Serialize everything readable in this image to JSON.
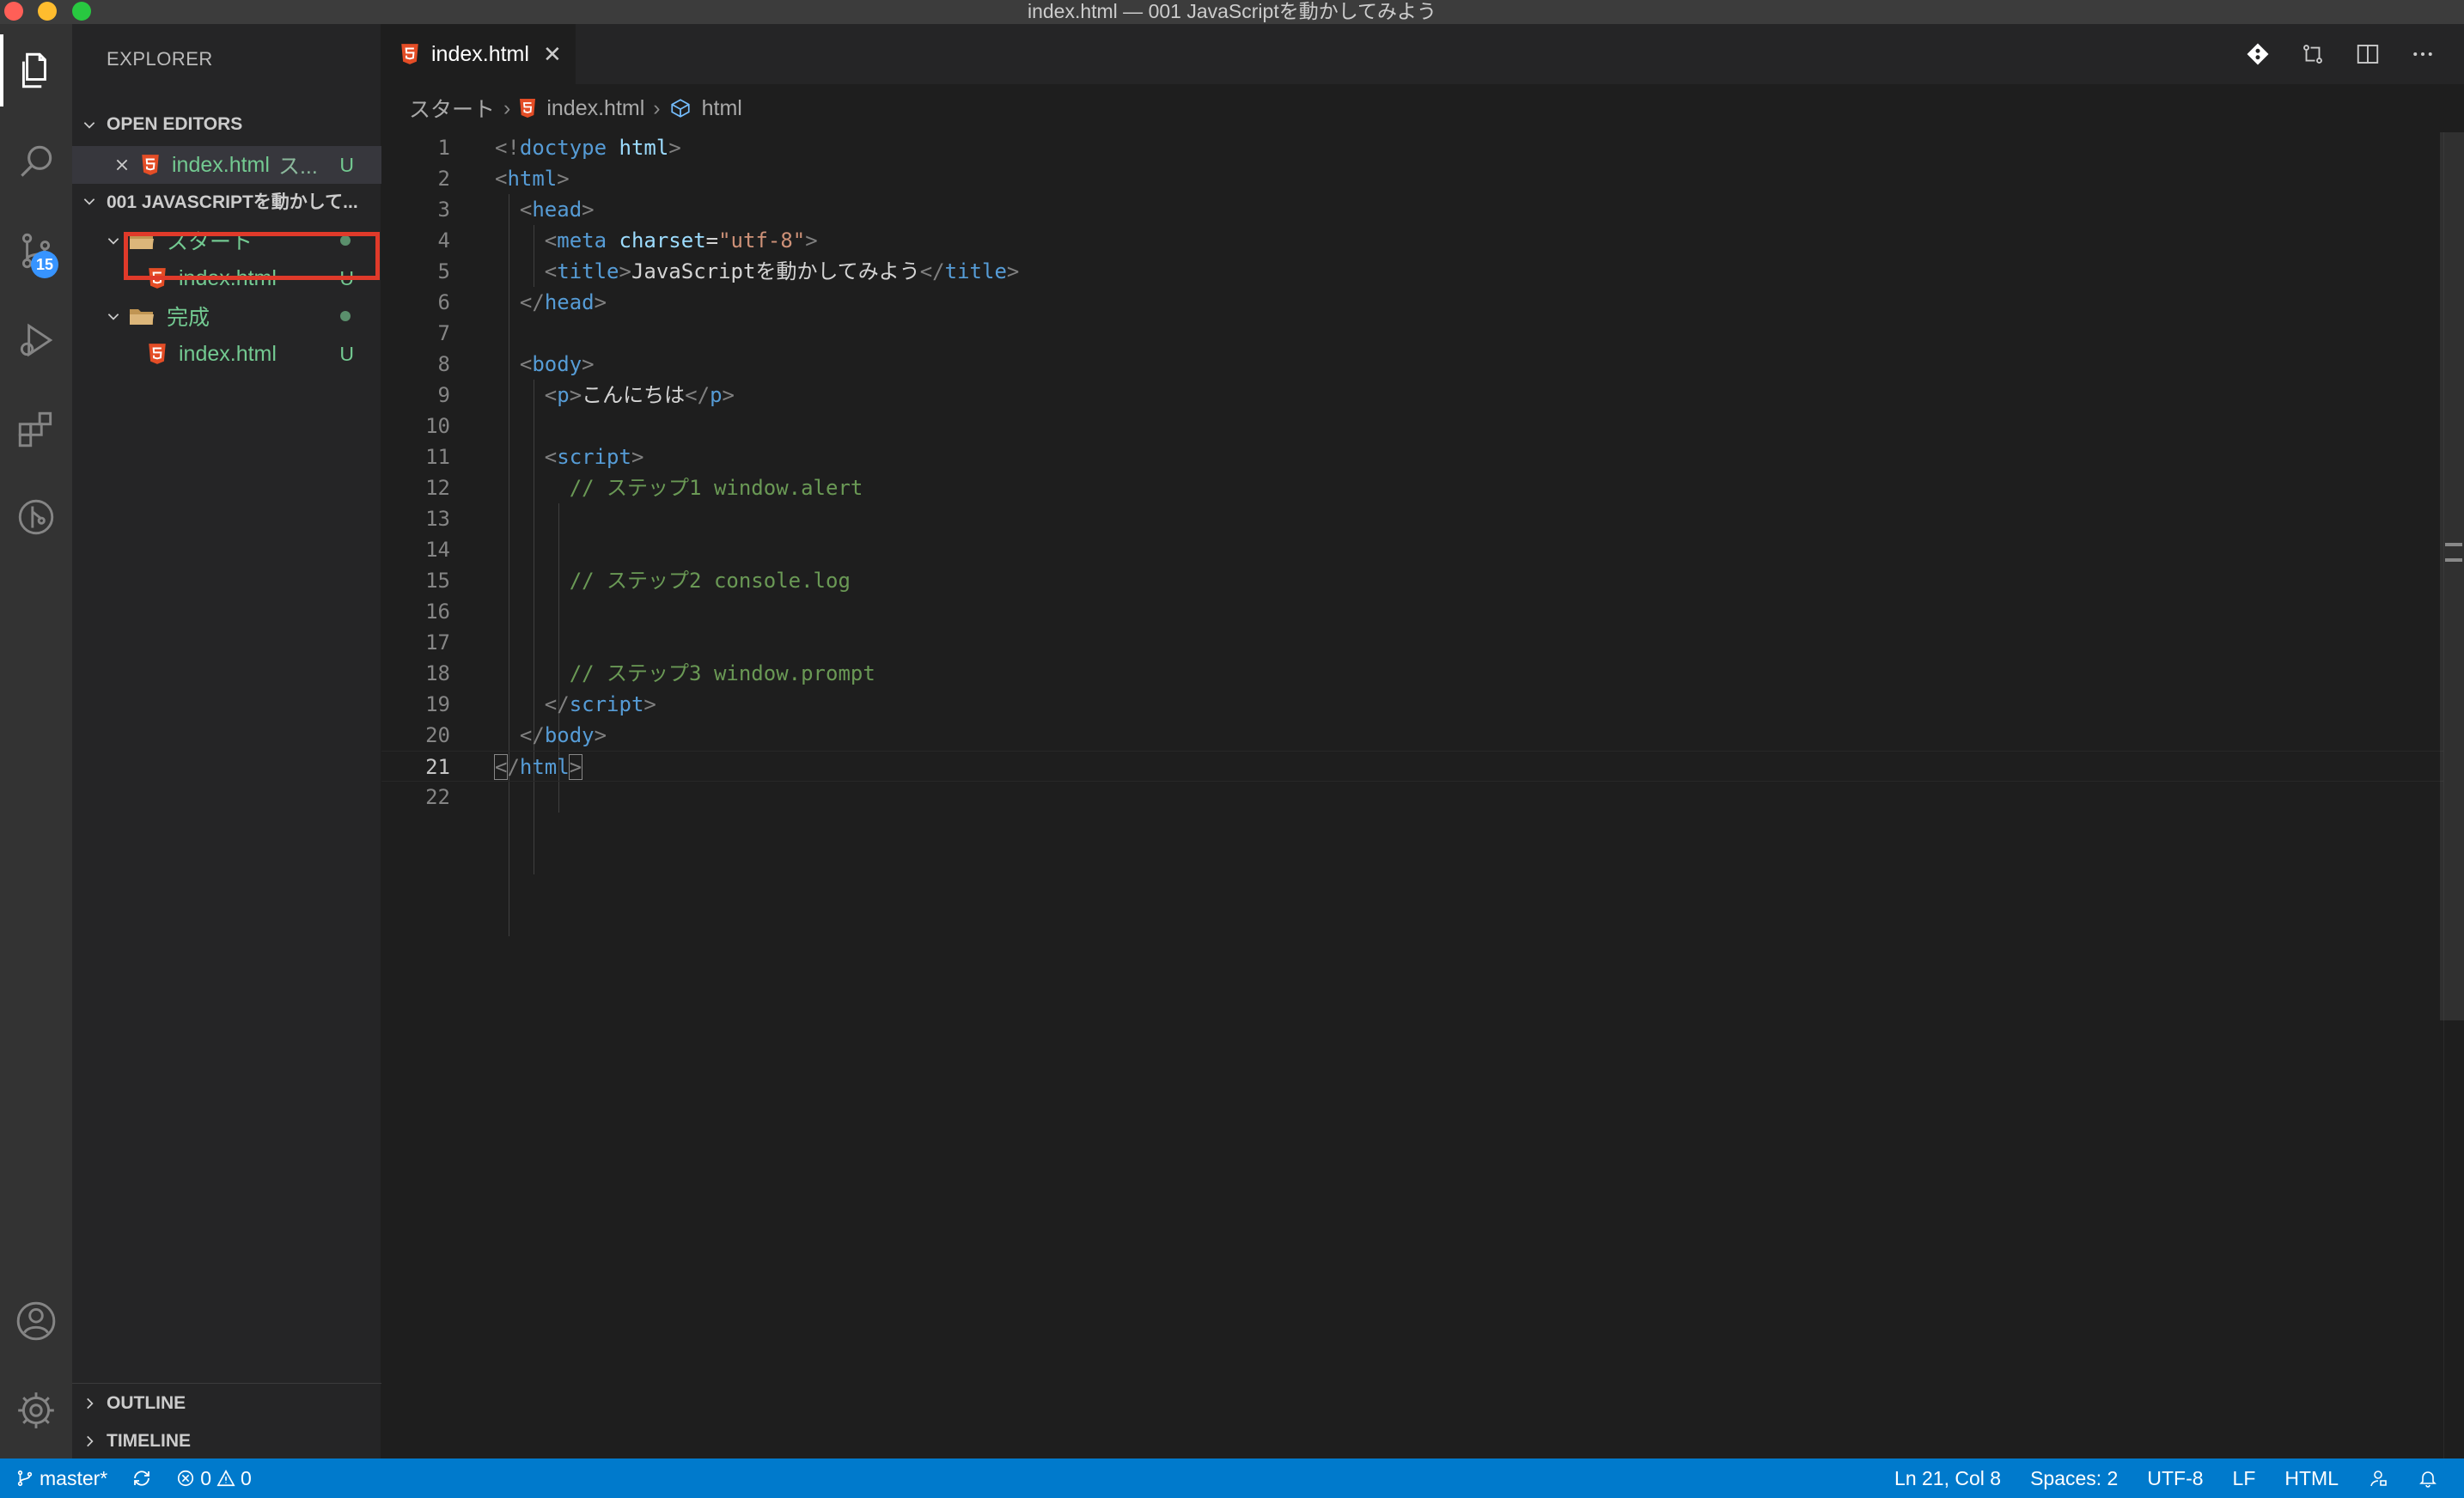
{
  "window": {
    "title": "index.html — 001 JavaScriptを動かしてみよう"
  },
  "sidebar": {
    "title": "EXPLORER",
    "open_editors": {
      "header": "OPEN EDITORS",
      "items": [
        {
          "name": "index.html",
          "desc": "ス...",
          "status": "U"
        }
      ]
    },
    "workspace": {
      "header": "001 JAVASCRIPTを動かして...",
      "folders": [
        {
          "name": "スタート",
          "files": [
            {
              "name": "index.html",
              "status": "U"
            }
          ]
        },
        {
          "name": "完成",
          "files": [
            {
              "name": "index.html",
              "status": "U"
            }
          ]
        }
      ]
    },
    "outline": "OUTLINE",
    "timeline": "TIMELINE"
  },
  "activity": {
    "source_control_badge": "15"
  },
  "tabs": [
    {
      "label": "index.html"
    }
  ],
  "breadcrumb": {
    "folder": "スタート",
    "file": "index.html",
    "symbol": "html"
  },
  "editor": {
    "line_numbers": [
      "1",
      "2",
      "3",
      "4",
      "5",
      "6",
      "7",
      "8",
      "9",
      "10",
      "11",
      "12",
      "13",
      "14",
      "15",
      "16",
      "17",
      "18",
      "19",
      "20",
      "21",
      "22"
    ],
    "tokens": {
      "doctype_kw": "doctype",
      "doctype_val": "html",
      "html": "html",
      "head": "head",
      "meta": "meta",
      "charset": "charset",
      "utf8": "\"utf-8\"",
      "title": "title",
      "title_text": "JavaScriptを動かしてみよう",
      "body": "body",
      "p": "p",
      "p_text": "こんにちは",
      "script": "script",
      "comment1": "// ステップ1 window.alert",
      "comment2": "// ステップ2 console.log",
      "comment3": "// ステップ3 window.prompt"
    }
  },
  "status": {
    "branch": "master*",
    "errors": "0",
    "warnings": "0",
    "position": "Ln 21, Col 8",
    "spaces": "Spaces: 2",
    "encoding": "UTF-8",
    "eol": "LF",
    "language": "HTML"
  },
  "colors": {
    "accent": "#007acc",
    "untracked": "#73c991",
    "highlight_box": "#e03a2a"
  }
}
